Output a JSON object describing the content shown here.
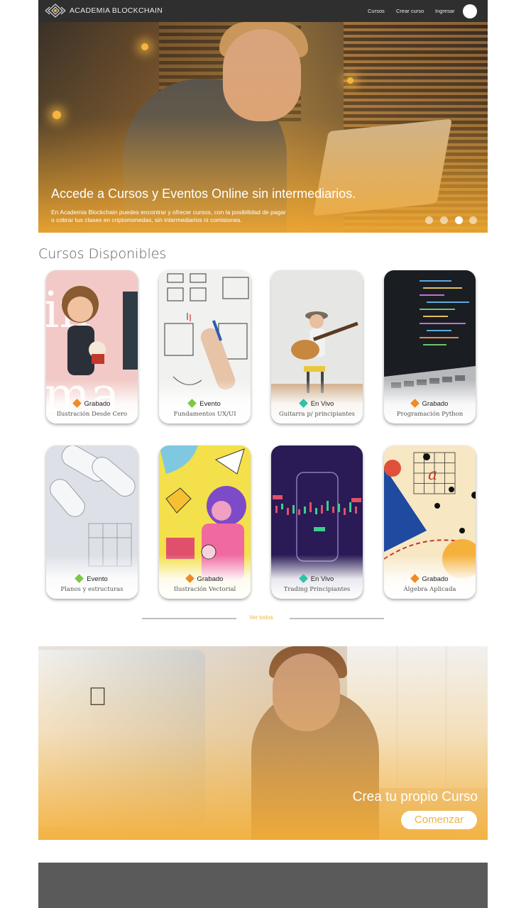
{
  "nav": {
    "brand": "ACADEMIA BLOCKCHAIN",
    "links": [
      "Cursos",
      "Crear curso",
      "Ingresar"
    ]
  },
  "hero": {
    "title": "Accede a Cursos y Eventos Online sin intermediarios.",
    "subtitle_line1": "En Academia Blockchain puedes encontrar y ofrecer cursos, con la posibilidad de pagar",
    "subtitle_line2": "o cobrar tus clases en criptomonedas, sin intermediarios ni comisiones.",
    "slides": 4,
    "active_slide": 3
  },
  "section": {
    "title": "Cursos Disponibles"
  },
  "courses": [
    {
      "type": "Grabado",
      "title": "Ilustración Desde Cero",
      "color": "#f08a24"
    },
    {
      "type": "Evento",
      "title": "Fundamentos UX/UI",
      "color": "#7ac943"
    },
    {
      "type": "En Vivo",
      "title": "Guitarra p/ principiantes",
      "color": "#2bc4a8"
    },
    {
      "type": "Grabado",
      "title": "Programación Python",
      "color": "#f08a24"
    },
    {
      "type": "Evento",
      "title": "Planos y estructuras",
      "color": "#7ac943"
    },
    {
      "type": "Grabado",
      "title": "Ilustración Vectorial",
      "color": "#f08a24"
    },
    {
      "type": "En Vivo",
      "title": "Trading Principiantes",
      "color": "#2bc4a8"
    },
    {
      "type": "Grabado",
      "title": "Álgebra Aplicada",
      "color": "#f08a24"
    }
  ],
  "ver_todos": "Ver todos",
  "cta": {
    "title": "Crea tu propio Curso",
    "button": "Comenzar"
  },
  "colors": {
    "accent": "#f0b43c",
    "nav_bg": "#2f2f2f",
    "footer_bg": "#5a5a5a"
  }
}
